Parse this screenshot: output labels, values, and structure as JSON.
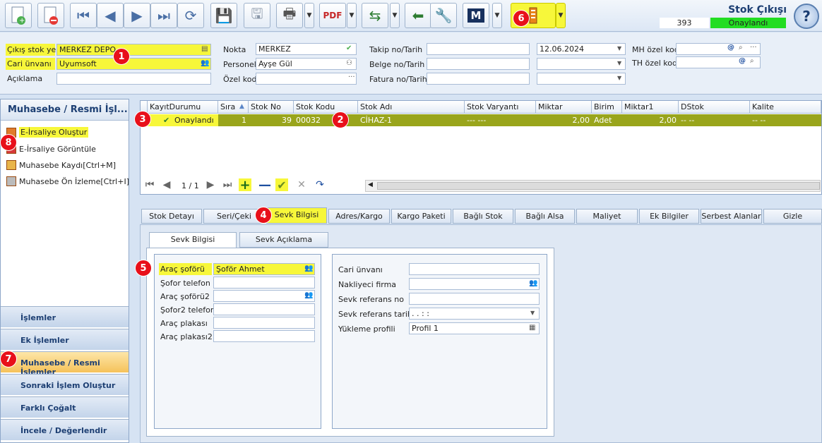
{
  "toolbar": {
    "icons": [
      "new-doc-icon",
      "delete-doc-icon",
      "first-record-icon",
      "prev-record-icon",
      "next-record-icon",
      "last-record-icon",
      "refresh-icon",
      "save-icon",
      "save-close-icon",
      "print-icon",
      "pdf-icon",
      "export-icon",
      "back-icon",
      "tools-icon",
      "m-icon",
      "status-icon"
    ],
    "m_label": "M",
    "title": "Stok Çıkışı",
    "doc_no": "393",
    "status": "Onaylandı",
    "help": "?"
  },
  "header": {
    "cikis_stok_yeri_label": "Çıkış stok yeri",
    "cikis_stok_yeri": "MERKEZ DEPO",
    "cari_unvani_label": "Cari ünvanı",
    "cari_unvani": "Uyumsoft",
    "aciklama_label": "Açıklama",
    "aciklama": "",
    "nokta_label": "Nokta",
    "nokta": "MERKEZ",
    "personel_label": "Personel",
    "personel": "Ayşe Gül",
    "ozel_kod_label": "Özel kod",
    "ozel_kod": "",
    "takip_label": "Takip no/Tarih",
    "takip_no": "",
    "takip_tarih": "12.06.2024",
    "belge_label": "Belge no/Tarih",
    "belge_no": "",
    "belge_tarih": "",
    "fatura_label": "Fatura no/Tarih",
    "fatura_no": "",
    "fatura_tarih": "",
    "mh_label": "MH özel kod",
    "mh_value": "",
    "th_label": "TH özel kod",
    "th_value": ""
  },
  "sidebar": {
    "title": "Muhasebe / Resmi İşl...",
    "items": [
      {
        "label": "E-İrsaliye Oluştur"
      },
      {
        "label": "E-İrsaliye Görüntüle"
      },
      {
        "label": "Muhasebe Kaydı[Ctrl+M]"
      },
      {
        "label": "Muhasebe Ön İzleme[Ctrl+I]"
      }
    ],
    "nav": [
      {
        "label": "İşlemler"
      },
      {
        "label": "Ek İşlemler"
      },
      {
        "label": "Muhasebe / Resmi İşlemler"
      },
      {
        "label": "Sonraki İşlem Oluştur"
      },
      {
        "label": "Farklı Çoğalt"
      },
      {
        "label": "İncele / Değerlendir"
      }
    ]
  },
  "grid": {
    "columns": [
      "KayıtDurumu",
      "Sıra",
      "Stok No",
      "Stok Kodu",
      "Stok Adı",
      "Stok Varyantı",
      "Miktar",
      "Birim",
      "Miktar1",
      "DStok",
      "Kalite"
    ],
    "rows": [
      {
        "kayit": "Onaylandı",
        "sira": "1",
        "stok_no": "39",
        "stok_kodu": "00032",
        "stok_adi": "CİHAZ-1",
        "varyant": "--- ---",
        "miktar": "2,00",
        "birim": "Adet",
        "miktar1": "2,00",
        "dstok": "-- --",
        "kalite": "-- --"
      }
    ],
    "pager": "1 / 1"
  },
  "tabs": [
    "Stok Detayı",
    "Seri/Çeki",
    "Sevk Bilgisi",
    "Adres/Kargo",
    "Kargo Paketi",
    "Bağlı Stok",
    "Bağlı Alsa",
    "Maliyet",
    "Ek Bilgiler",
    "Serbest Alanlar",
    "Gizle"
  ],
  "subtabs": [
    "Sevk Bilgisi",
    "Sevk Açıklama"
  ],
  "sevk": {
    "arac_soforu_label": "Araç şoförü",
    "arac_soforu": "Şoför Ahmet",
    "sofor_telefon_label": "Şofor telefon",
    "arac_soforu2_label": "Araç şoförü2",
    "sofor2_telefon_label": "Şofor2 telefon",
    "arac_plakasi_label": "Araç plakası",
    "arac_plakasi2_label": "Araç plakası2",
    "cari_unvani_label": "Cari ünvanı",
    "nakliyeci_label": "Nakliyeci firma",
    "sevk_ref_no_label": "Sevk referans no",
    "sevk_ref_tarih_label": "Sevk referans tarihi",
    "sevk_ref_tarih": " .  .      :  :",
    "yukleme_profili_label": "Yükleme profili",
    "yukleme_profili": "Profil 1"
  },
  "badges": [
    "1",
    "2",
    "3",
    "4",
    "5",
    "6",
    "7",
    "8"
  ]
}
